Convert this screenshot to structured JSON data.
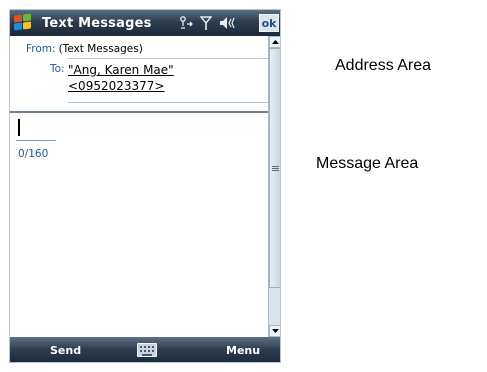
{
  "window": {
    "title": "Text Messages",
    "ok_label": "ok"
  },
  "status_icons": [
    "connectivity-icon",
    "signal-icon",
    "volume-icon"
  ],
  "address_area": {
    "from_label": "From:",
    "from_value": "(Text Messages)",
    "to_label": "To:",
    "to_value_line1": "\"Ang, Karen Mae\"",
    "to_value_line2": "<0952023377>"
  },
  "message_area": {
    "body": "",
    "char_count": "0/160"
  },
  "softkeys": {
    "left": "Send",
    "right": "Menu"
  },
  "annotations": {
    "address": "Address Area",
    "message": "Message Area"
  },
  "colors": {
    "title_bar": "#2c3d50",
    "label_blue": "#1f5ea0"
  }
}
